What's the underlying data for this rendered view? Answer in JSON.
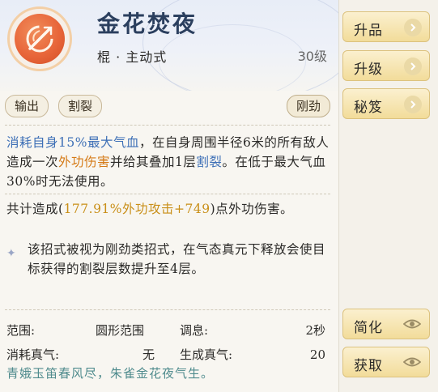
{
  "skill": {
    "title": "金花焚夜",
    "subtitle": "棍 · 主动式",
    "level": "30级",
    "icon": "staff-emblem-icon",
    "icon_color": "#e8663a"
  },
  "tags": [
    "输出",
    "割裂",
    "刚劲"
  ],
  "description": {
    "p1": "消耗自身15%最大气血",
    "p2": "，在自身周围半径6米的所有敌人造成一次",
    "p3": "外功伤害",
    "p4": "并给其叠加1层",
    "p5": "割裂",
    "p6": "。在低于最大气血30%时无法使用。"
  },
  "damage": {
    "prefix": "共计造成(",
    "formula": "177.91%外功攻击+749",
    "suffix": ")点外功伤害。"
  },
  "note": "该招式被视为刚劲类招式，在气态真元下释放会使目标获得的割裂层数提升至4层。",
  "stats": {
    "range_label": "范围:",
    "range_value": "圆形范围",
    "cooldown_label": "调息:",
    "cooldown_value": "2秒",
    "cost_label": "消耗真气:",
    "cost_value": "无",
    "gen_label": "生成真气:",
    "gen_value": "20"
  },
  "poem": "青娥玉笛春风尽，朱雀金花夜气生。",
  "side_buttons": {
    "upgrade_grade": "升品",
    "upgrade_level": "升级",
    "secret_manual": "秘笈",
    "simplify": "简化",
    "obtain": "获取"
  },
  "colors": {
    "blue_text": "#3d6fb6",
    "orange_text": "#d57a16",
    "gold_text": "#c98f18",
    "poem_text": "#4f8b8d",
    "button_bg": "#f2dc9a"
  }
}
